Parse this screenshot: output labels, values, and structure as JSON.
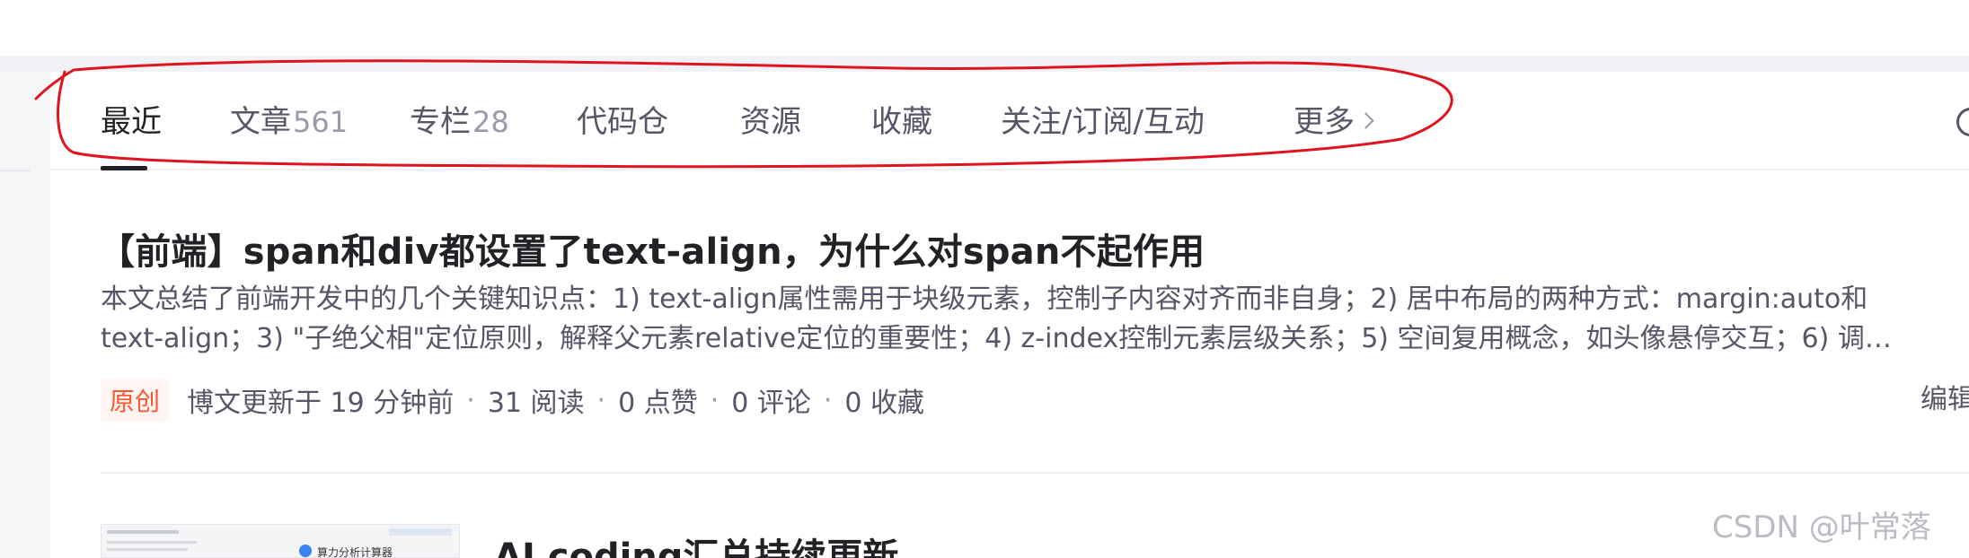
{
  "tabs": [
    {
      "label": "最近",
      "count": ""
    },
    {
      "label": "文章",
      "count": "561"
    },
    {
      "label": "专栏",
      "count": "28"
    },
    {
      "label": "代码仓",
      "count": ""
    },
    {
      "label": "资源",
      "count": ""
    },
    {
      "label": "收藏",
      "count": ""
    },
    {
      "label": "关注/订阅/互动",
      "count": ""
    },
    {
      "label": "更多",
      "count": ""
    }
  ],
  "article": {
    "title": "【前端】span和div都设置了text-align，为什么对span不起作用",
    "summary_line1": "本文总结了前端开发中的几个关键知识点：1) text-align属性需用于块级元素，控制子内容对齐而非自身；2) 居中布局的两种方式：margin:auto和",
    "summary_line2": "text-align；3) \"子绝父相\"定位原则，解释父元素relative定位的重要性；4) z-index控制元素层级关系；5) 空间复用概念，如头像悬停交互；6) 调…",
    "badge": "原创",
    "updated": "博文更新于 19 分钟前",
    "reads": "31 阅读",
    "likes": "0 点赞",
    "comments": "0 评论",
    "favorites": "0 收藏",
    "edit": "编辑",
    "separator": "·"
  },
  "article2": {
    "title": "AI coding汇总持续更新",
    "thumb_text": "算力分析计算器"
  },
  "watermark": "CSDN @叶常落",
  "colors": {
    "annotation": "#e0141e",
    "badge_text": "#fc5531",
    "badge_bg": "#fff5f2"
  }
}
